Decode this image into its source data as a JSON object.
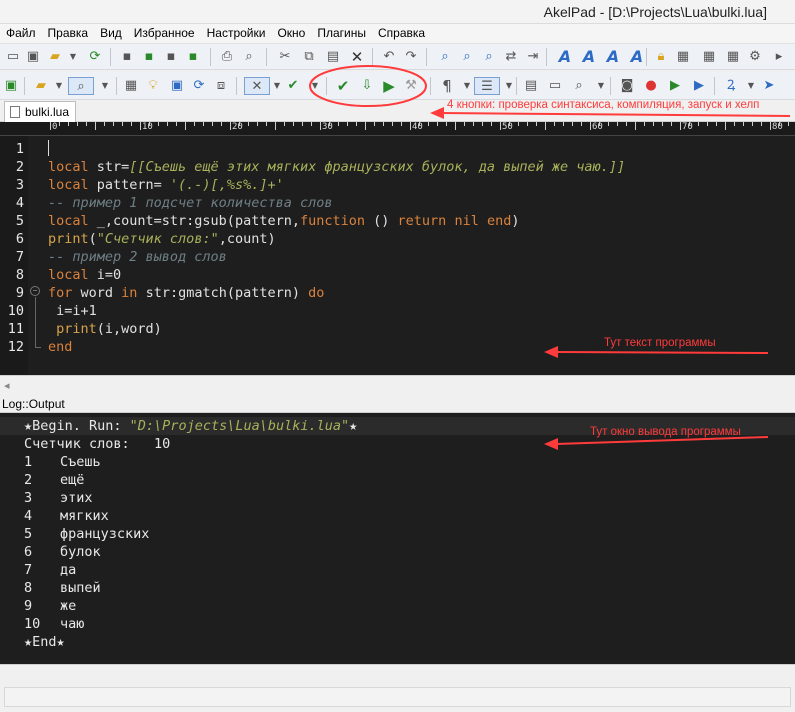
{
  "window": {
    "title": "AkelPad - [D:\\Projects\\Lua\\bulki.lua]"
  },
  "menu": [
    "Файл",
    "Правка",
    "Вид",
    "Избранное",
    "Настройки",
    "Окно",
    "Плагины",
    "Справка"
  ],
  "tab": {
    "label": "bulki.lua"
  },
  "ruler": {
    "labels": [
      "0",
      "10",
      "20",
      "30",
      "40",
      "50",
      "60",
      "70",
      "80"
    ]
  },
  "editor": {
    "line_numbers": [
      "1",
      "2",
      "3",
      "4",
      "5",
      "6",
      "7",
      "8",
      "9",
      "10",
      "11",
      "12"
    ]
  },
  "log": {
    "label": "Log::Output"
  },
  "output": {
    "begin": "★Begin. Run: ",
    "begin_path": "\"D:\\Projects\\Lua\\bulki.lua\"",
    "begin_star": "★",
    "count_line": "Счетчик слов:   10",
    "rows": [
      {
        "n": "1",
        "w": "Съешь"
      },
      {
        "n": "2",
        "w": "ещё"
      },
      {
        "n": "3",
        "w": "этих"
      },
      {
        "n": "4",
        "w": "мягких"
      },
      {
        "n": "5",
        "w": "французских"
      },
      {
        "n": "6",
        "w": "булок"
      },
      {
        "n": "7",
        "w": "да"
      },
      {
        "n": "8",
        "w": "выпей"
      },
      {
        "n": "9",
        "w": "же"
      },
      {
        "n": "10",
        "w": "чаю"
      }
    ],
    "end": "★End★"
  },
  "annotations": {
    "buttons": "4 кнопки: проверка синтаксиса, компиляция, запуск и хелп",
    "code": "Тут текст программы",
    "output": "Тут окно вывода программы"
  },
  "colors": {
    "annotation": "#ff3b3b",
    "editor_bg": "#1e1e1e",
    "keyword": "#d9823c",
    "string": "#a8b15a",
    "comment": "#6f7f86"
  }
}
